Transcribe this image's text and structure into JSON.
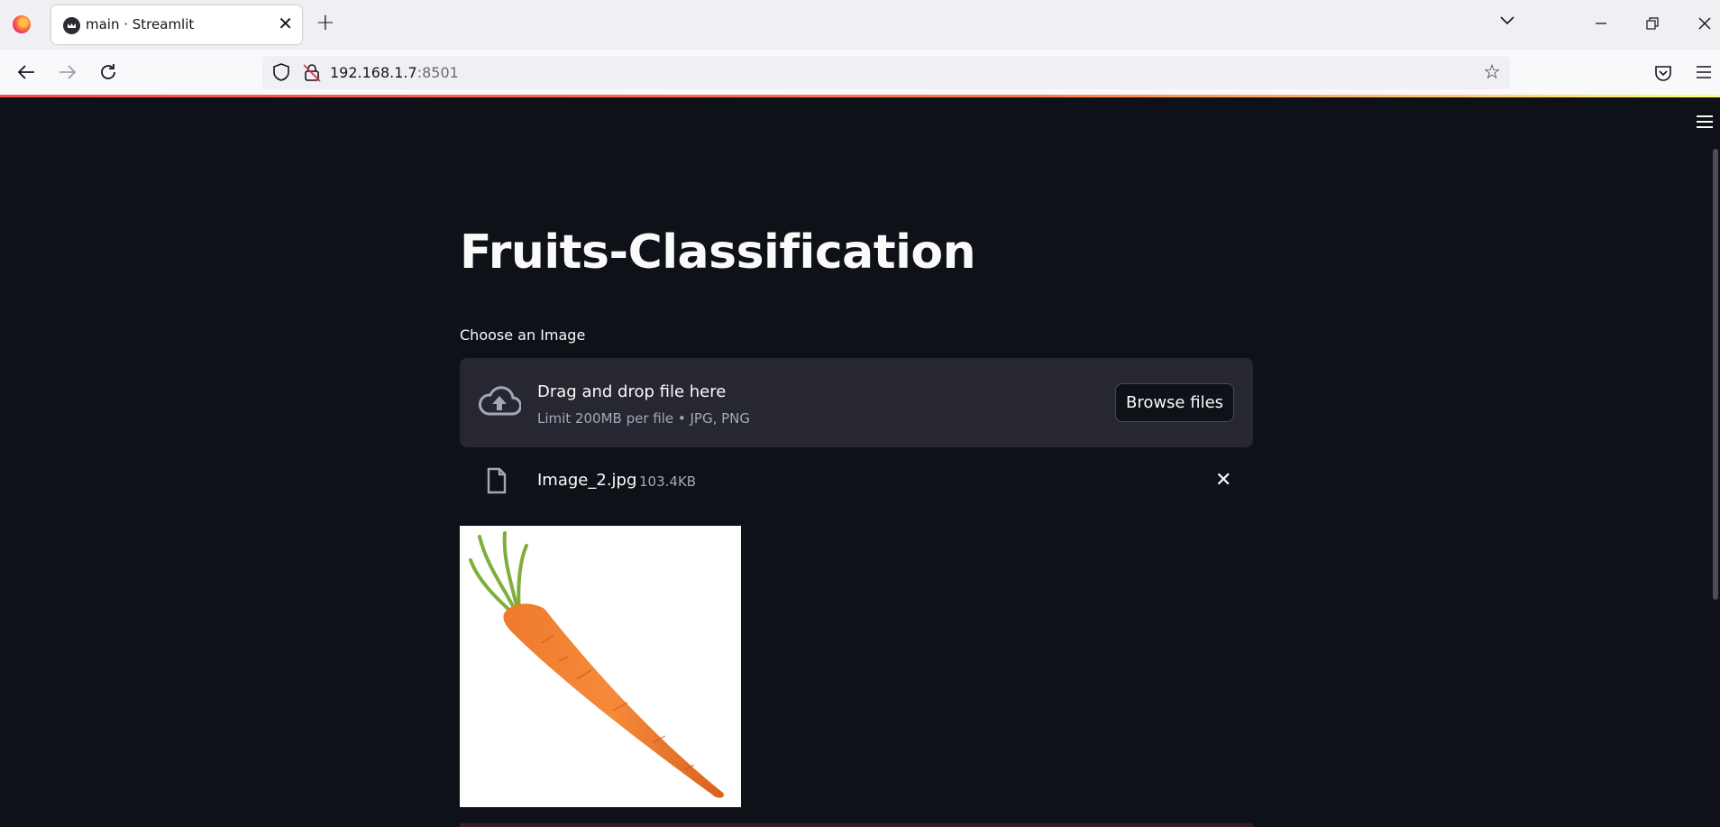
{
  "browser": {
    "tab_title": "main · Streamlit",
    "url_host": "192.168.1.7",
    "url_port": ":8501"
  },
  "app": {
    "title": "Fruits-Classification",
    "uploader": {
      "label": "Choose an Image",
      "drop_text": "Drag and drop file here",
      "limit_text": "Limit 200MB per file • JPG, PNG",
      "browse_label": "Browse files"
    },
    "uploaded_file": {
      "name": "Image_2.jpg",
      "size": "103.4KB"
    }
  },
  "colors": {
    "background": "#0e1117",
    "dropzone": "#262730",
    "text": "#fafafa",
    "muted": "#a3a8b8",
    "accent": "#ff4b4b"
  }
}
